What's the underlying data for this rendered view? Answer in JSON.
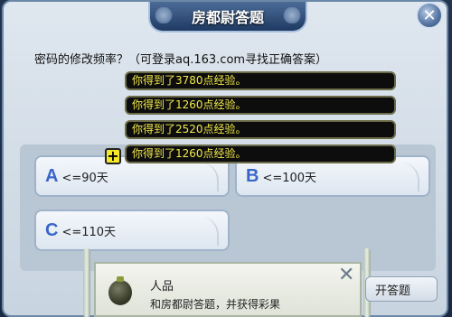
{
  "window": {
    "title": "房都尉答题",
    "close_icon": "close-icon"
  },
  "question": {
    "text": "密码的修改频率？（可登录aq.163.com寻找正确答案）"
  },
  "answers": [
    {
      "letter": "A",
      "text": "<=90天"
    },
    {
      "letter": "B",
      "text": "<=100天"
    },
    {
      "letter": "C",
      "text": "<=110天"
    }
  ],
  "notifications": [
    "你得到了3780点经验。",
    "你得到了1260点经验。",
    "你得到了2520点经验。",
    "你得到了1260点经验。"
  ],
  "plus_symbol": "+",
  "reward_popup": {
    "item_name": "人品",
    "description": "和房都尉答题，并获得彩果",
    "close_symbol": "✕"
  },
  "start_button": {
    "label": "开答题"
  },
  "colors": {
    "notification_text": "#f2e94a",
    "answer_letter": "#3a66c8",
    "title_bar": "#1f3a63"
  }
}
